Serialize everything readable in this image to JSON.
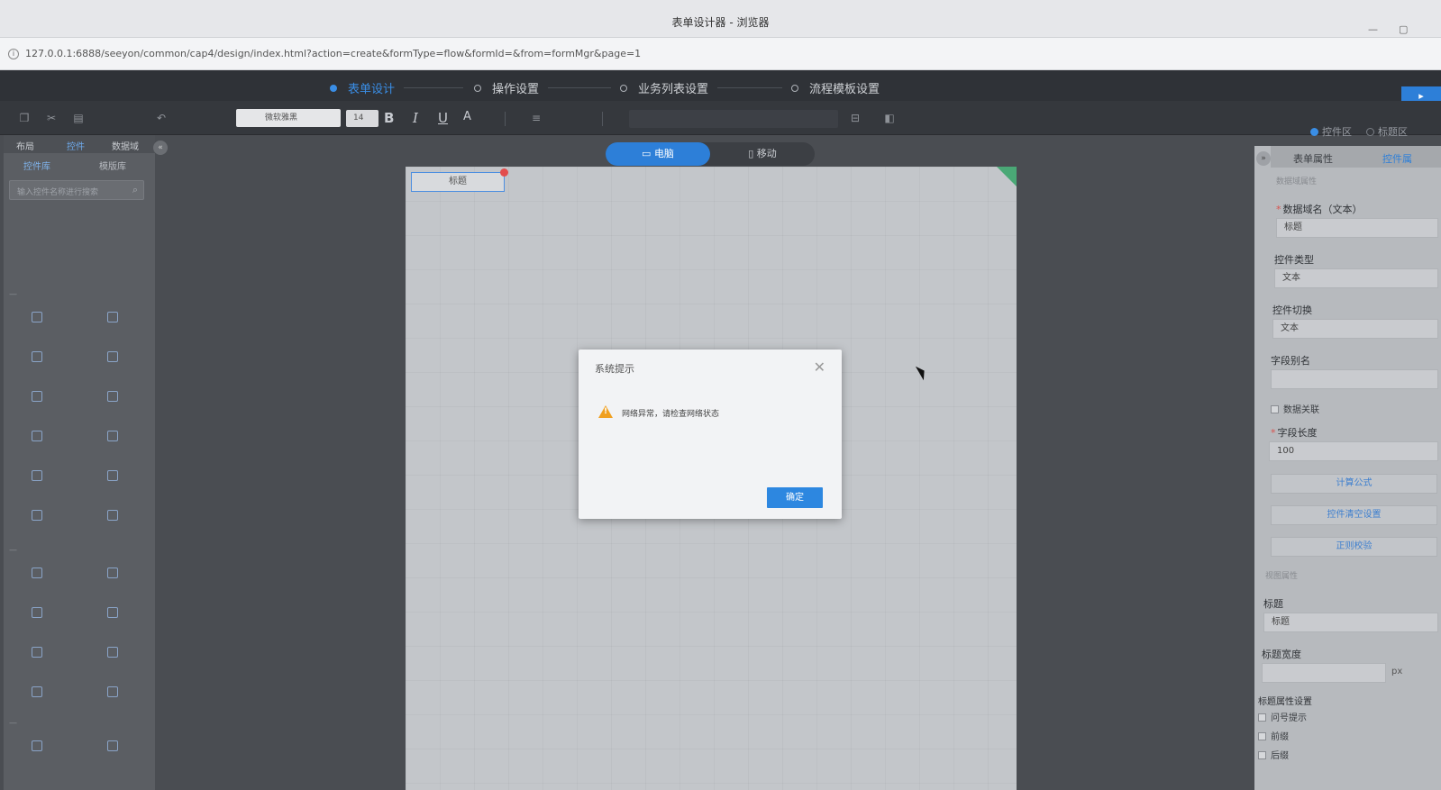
{
  "window": {
    "title": "表单设计器 - 浏览器",
    "url": "127.0.0.1:6888/seeyon/common/cap4/design/index.html?action=create&formType=flow&formId=&from=formMgr&page=1"
  },
  "wizard": {
    "steps": [
      {
        "label": "表单设计",
        "active": true
      },
      {
        "label": "操作设置",
        "active": false
      },
      {
        "label": "业务列表设置",
        "active": false
      },
      {
        "label": "流程模板设置",
        "active": false
      }
    ]
  },
  "toolbar": {
    "font_family": "微软雅黑",
    "font_size": "14",
    "bold": "B",
    "italic": "I",
    "underline": "U",
    "font_color": "A",
    "mode_options": [
      {
        "label": "控件区",
        "selected": true
      },
      {
        "label": "标题区",
        "selected": false
      }
    ]
  },
  "left_panel": {
    "tabs": [
      {
        "label": "布局",
        "active": false
      },
      {
        "label": "控件",
        "active": true
      },
      {
        "label": "数据域",
        "active": false
      }
    ],
    "subtabs": [
      {
        "label": "控件库",
        "active": true
      },
      {
        "label": "模版库",
        "active": false
      }
    ],
    "search_placeholder": "输入控件名称进行搜索"
  },
  "device_toggle": {
    "pc": "电脑",
    "mobile": "移动"
  },
  "canvas": {
    "field_label": "标题"
  },
  "right_panel": {
    "tabs": [
      {
        "label": "表单属性",
        "active": false
      },
      {
        "label": "控件属",
        "active": true
      }
    ],
    "section_data": "数据域属性",
    "data_field_label": "数据域名（文本）",
    "data_field_value": "标题",
    "control_type_label": "控件类型",
    "control_type_value": "文本",
    "control_switch_label": "控件切换",
    "control_switch_value": "文本",
    "field_alias_label": "字段别名",
    "field_alias_value": "",
    "data_link_label": "数据关联",
    "field_length_label": "字段长度",
    "field_length_value": "100",
    "btn_formula": "计算公式",
    "btn_clear": "控件清空设置",
    "btn_regex": "正则校验",
    "section_view": "视图属性",
    "title_label": "标题",
    "title_value": "标题",
    "title_width_label": "标题宽度",
    "title_width_unit": "px",
    "title_attr_label": "标题属性设置",
    "check_question": "问号提示",
    "check_prefix": "前缀",
    "check_suffix": "后缀"
  },
  "modal": {
    "title": "系统提示",
    "message": "网络异常，请检查网络状态",
    "ok_label": "确定"
  }
}
